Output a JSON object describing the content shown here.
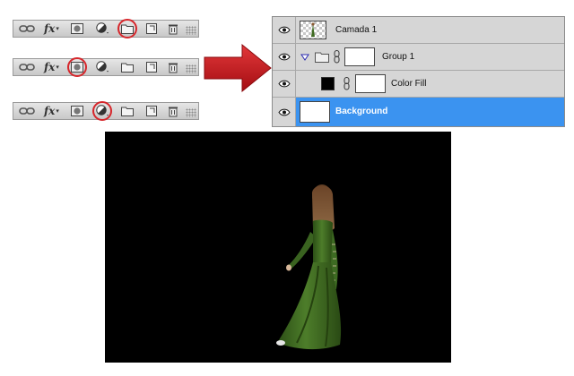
{
  "toolbars": [
    {
      "highlighted": "new-group"
    },
    {
      "highlighted": "add-mask"
    },
    {
      "highlighted": "adjustment-layer"
    }
  ],
  "toolbar_buttons": [
    "link-icon",
    "fx-icon",
    "mask-icon",
    "adjustment-icon",
    "folder-icon",
    "new-layer-icon",
    "trash-icon"
  ],
  "fx_label": "fx",
  "layers": [
    {
      "name": "Camada 1",
      "type": "pixel"
    },
    {
      "name": "Group 1",
      "type": "group"
    },
    {
      "name": "Color Fill",
      "type": "fill"
    },
    {
      "name": "Background",
      "type": "background",
      "selected": true
    }
  ],
  "colors": {
    "highlight_ring": "#d6262b",
    "arrow": "#c8151b",
    "selection": "#3b93f0",
    "canvas": "#000000",
    "dress": "#3f6b22"
  }
}
